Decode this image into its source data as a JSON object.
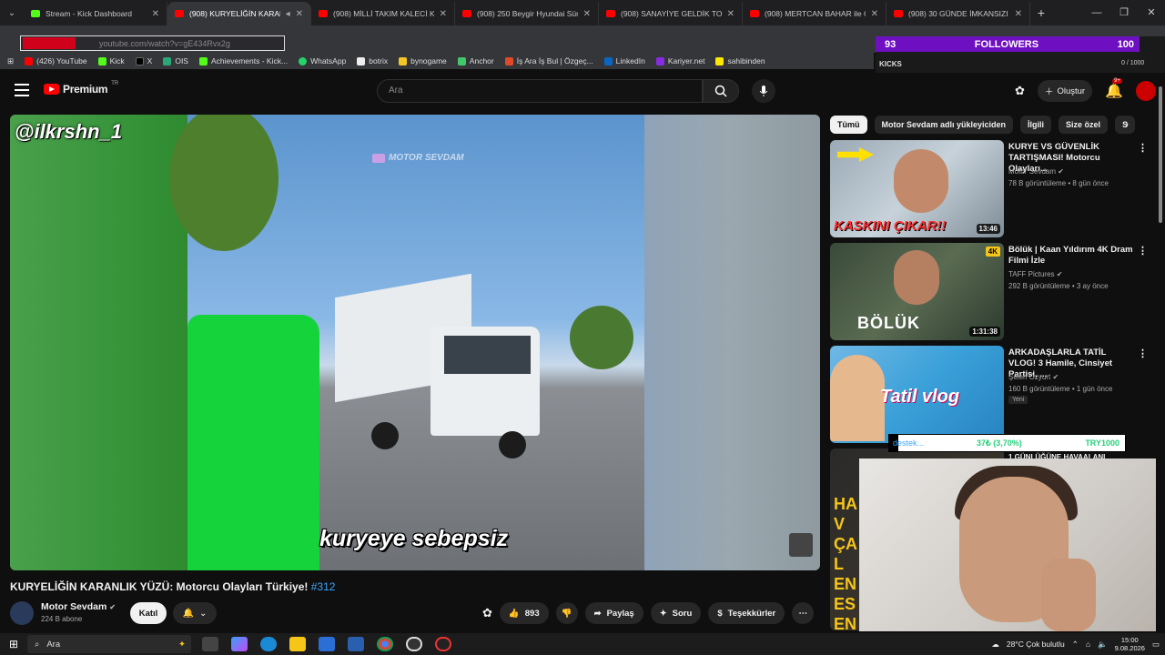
{
  "browser": {
    "tabs": [
      {
        "title": "Stream - Kick Dashboard",
        "favicon": "kick-icon"
      },
      {
        "title": "(908) KURYELİĞİN KARANLI",
        "favicon": "youtube-icon",
        "active": true
      },
      {
        "title": "(908) MİLLİ TAKIM KALECİ KAM",
        "favicon": "youtube-icon"
      },
      {
        "title": "(908) 250 Beygir Hyundai Süre",
        "favicon": "youtube-icon"
      },
      {
        "title": "(908) SANAYİYE GELDİK TOFA",
        "favicon": "youtube-icon"
      },
      {
        "title": "(908) MERTCAN BAHAR ile CEZ",
        "favicon": "youtube-icon"
      },
      {
        "title": "(908) 30 GÜNDE İMKANSIZI BA",
        "favicon": "youtube-icon"
      }
    ],
    "url": "youtube.com/watch?v=gE434Rvx2g",
    "bookmarks": [
      "(426) YouTube",
      "Kick",
      "X",
      "OIS",
      "Achievements - Kick...",
      "WhatsApp",
      "botrix",
      "bynogame",
      "Anchor",
      "İş Ara İş Bul | Özgeç...",
      "LinkedIn",
      "Kariyer.net",
      "sahibinden"
    ]
  },
  "stream_overlay": {
    "followers_current": "93",
    "followers_label": "FOLLOWERS",
    "followers_goal": "100",
    "kicks_label": "KICKS",
    "kicks_value": "0 / 1000"
  },
  "youtube": {
    "logo_text": "Premium",
    "logo_tm": "TR",
    "search_placeholder": "Ara",
    "create_label": "Oluştur",
    "notif_badge": "9+"
  },
  "video": {
    "watermark_handle": "@ilkrshn_1",
    "watermark_channel": "MOTOR SEVDAM",
    "subtitle": "kuryeye sebepsiz",
    "title": "KURYELİĞİN KARANLIK YÜZÜ: Motorcu Olayları Türkiye!",
    "title_tag": "#312",
    "channel_name": "Motor Sevdam",
    "channel_subs": "224 B abone",
    "join_label": "Katıl",
    "likes": "893",
    "share_label": "Paylaş",
    "ask_label": "Soru",
    "thanks_label": "Teşekkürler"
  },
  "sidebar": {
    "chips": [
      "Tümü",
      "Motor Sevdam adlı yükleyiciden",
      "İlgili",
      "Size özel",
      "S"
    ],
    "recs": [
      {
        "title": "KURYE VS GÜVENLİK TARTIŞMASI! Motorcu Olayları...",
        "channel": "Motor Sevdam",
        "meta": "78 B görüntüleme • 8 gün önce",
        "duration": "13:46",
        "thumb_text": "KASKINI ÇIKAR!!"
      },
      {
        "title": "Bölük | Kaan Yıldırım 4K Dram Filmi İzle",
        "channel": "TAFF Pictures",
        "meta": "292 B görüntüleme • 3 ay önce",
        "duration": "1:31:38",
        "thumb_text": "BÖLÜK",
        "thumb_badge": "4K"
      },
      {
        "title": "ARKADAŞLARLA TATİL VLOG! 3 Hamile, Cinsiyet Partisi, ...",
        "channel": "Şelen Özyurt",
        "meta": "160 B görüntüleme • 1 gün önce",
        "badge": "Yeni",
        "thumb_text": "Tatil vlog"
      },
      {
        "title": "1 GÜNLÜĞÜNE HAVAALANI",
        "thumb_text": "HAV ÇAL ENES EN Ç"
      }
    ],
    "donation": {
      "label": "destek...",
      "progress": "37₺ (3,70%)",
      "goal": "TRY1000",
      "fraction": 0.037
    }
  },
  "taskbar": {
    "search": "Ara",
    "weather": "28°C  Çok bulutlu",
    "time": "15:00",
    "date": "9.08.2026"
  },
  "colors": {
    "kick_green": "#53fc18",
    "yt_red": "#ff0000",
    "overlay_purple": "#6f0fc2"
  }
}
